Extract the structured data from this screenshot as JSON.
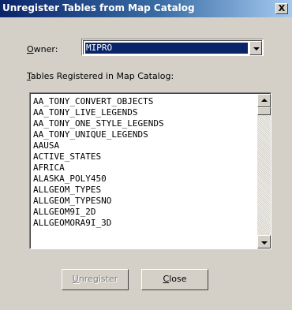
{
  "window": {
    "title": "Unregister Tables from Map Catalog",
    "close_glyph": "X"
  },
  "owner": {
    "label_accel": "O",
    "label_rest": "wner:",
    "selected": "MIPRO"
  },
  "tables": {
    "label_accel": "T",
    "label_rest": "ables Registered in Map Catalog:",
    "items": [
      "AA_TONY_CONVERT_OBJECTS",
      "AA_TONY_LIVE_LEGENDS",
      "AA_TONY_ONE_STYLE_LEGENDS",
      "AA_TONY_UNIQUE_LEGENDS",
      "AAUSA",
      "ACTIVE_STATES",
      "AFRICA",
      "ALASKA_POLY450",
      "ALLGEOM_TYPES",
      "ALLGEOM_TYPESNO",
      "ALLGEOM9I_2D",
      "ALLGEOMORA9I_3D"
    ]
  },
  "buttons": {
    "unregister_accel": "U",
    "unregister_rest": "nregister",
    "unregister_enabled": false,
    "close_accel": "C",
    "close_rest": "lose"
  },
  "icons": {
    "dropdown": "chevron-down-icon",
    "scroll_up": "arrow-up-icon",
    "scroll_down": "arrow-down-icon"
  }
}
